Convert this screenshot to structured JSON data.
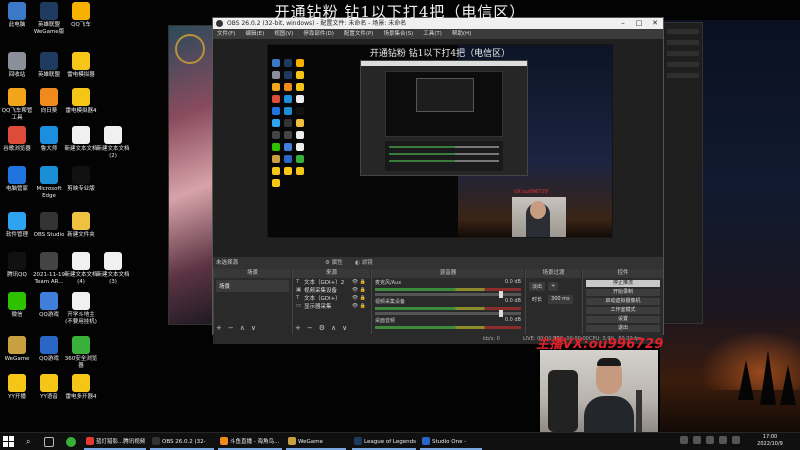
{
  "stream_title": "开通钻粉 钻1以下打4把（电信区）",
  "desktop_icons": [
    {
      "label": "此电脑",
      "color": "#3b78c8"
    },
    {
      "label": "回收站",
      "color": "#8a8f99"
    },
    {
      "label": "QQ飞车帮管工具",
      "color": "#f2a51a"
    },
    {
      "label": "谷歌浏览器",
      "color": "#dd4b39"
    },
    {
      "label": "电脑管家",
      "color": "#1f74e0"
    },
    {
      "label": "软件管理",
      "color": "#2ea3f2"
    },
    {
      "label": "腾讯QQ",
      "color": "#111111"
    },
    {
      "label": "微信",
      "color": "#2dc100"
    },
    {
      "label": "WeGame",
      "color": "#c8a040"
    },
    {
      "label": "YY开播",
      "color": "#f5c518"
    },
    {
      "label": "英雄联盟WeGame版",
      "color": "#1e3a5f"
    },
    {
      "label": "英雄联盟",
      "color": "#1e3a5f"
    },
    {
      "label": "向日葵",
      "color": "#f08a1c"
    },
    {
      "label": "鲁大师",
      "color": "#1c8ee0"
    },
    {
      "label": "Microsoft Edge",
      "color": "#1b8fd6"
    },
    {
      "label": "OBS Studio",
      "color": "#333333"
    },
    {
      "label": "2021-11-19 Team AR...",
      "color": "#444444"
    },
    {
      "label": "QQ游戏",
      "color": "#3f7fd9"
    },
    {
      "label": "QQ游戏",
      "color": "#2a66c4"
    },
    {
      "label": "YY语音",
      "color": "#f5c518"
    },
    {
      "label": "QQ飞车",
      "color": "#f5b000"
    },
    {
      "label": "雷电模拟器",
      "color": "#f5c518"
    },
    {
      "label": "雷电模拟器4",
      "color": "#f5c518"
    },
    {
      "label": "新建文本文档",
      "color": "#f0f0f0"
    },
    {
      "label": "剪映专业版",
      "color": "#111111"
    },
    {
      "label": "新建文件夹",
      "color": "#f0c040"
    },
    {
      "label": "新建文本文档 (4)",
      "color": "#f0f0f0"
    },
    {
      "label": "开学斗地主(不要用挂机)",
      "color": "#f0f0f0"
    },
    {
      "label": "360安全浏览器",
      "color": "#38b03a"
    },
    {
      "label": "雷电多开器4",
      "color": "#f5c518"
    },
    {
      "label": "新建文本文档 (2)",
      "color": "#f0f0f0"
    },
    {
      "label": "新建文本文档 (3)",
      "color": "#f0f0f0"
    }
  ],
  "obs": {
    "title": "OBS 26.0.2 (32-bit, windows) - 配置文件: 未命名 - 场景: 未命名",
    "menu": [
      "文件(F)",
      "编辑(E)",
      "视图(V)",
      "停靠部件(D)",
      "配置文件(P)",
      "场景集合(S)",
      "工具(T)",
      "帮助(H)"
    ],
    "canvas_title": "开通钻粉 钻1以下打4把（电信区）",
    "canvas_watermark": "VX:ou996729",
    "context": {
      "no_source": "未选择源",
      "properties": "属性",
      "filters": "滤镜"
    },
    "docks": {
      "scenes": {
        "header": "场景",
        "items": [
          "场景"
        ]
      },
      "sources": {
        "header": "来源",
        "items": [
          {
            "type": "T",
            "label": "文本（GDI+）2"
          },
          {
            "type": "▣",
            "label": "视频采集设备"
          },
          {
            "type": "T",
            "label": "文本（GDI+）"
          },
          {
            "type": "▭",
            "label": "显示器采集"
          }
        ]
      },
      "mixer": {
        "header": "混音器",
        "channels": [
          {
            "label": "麦克风/Aux",
            "db": "0.0 dB",
            "level": 0.55
          },
          {
            "label": "视频采集设备",
            "db": "0.0 dB",
            "level": 0.45
          },
          {
            "label": "桌面音频",
            "db": "0.0 dB",
            "level": 0.35
          }
        ]
      },
      "transitions": {
        "header": "场景过渡",
        "type": "淡出",
        "duration_label": "时长",
        "duration": "300 ms"
      },
      "controls": {
        "header": "控件",
        "buttons": [
          {
            "label": "停止推流",
            "active": true
          },
          {
            "label": "开始录制",
            "active": false
          },
          {
            "label": "启动虚拟摄像机",
            "active": false
          },
          {
            "label": "工作室模式",
            "active": false
          },
          {
            "label": "设置",
            "active": false
          },
          {
            "label": "退出",
            "active": false
          }
        ]
      }
    },
    "status": {
      "live": "LIVE: 00:00:00",
      "rec": "REC: 00:00:00",
      "cpu": "CPU: 0.9%, 60.00 fps",
      "kbps": "kb/s: 0"
    }
  },
  "streamer_vx": "主播VX:ou996729",
  "taskbar": {
    "apps": [
      {
        "label": "蓝灯猎影...腾讯视频",
        "color": "#e53935"
      },
      {
        "label": "OBS 26.0.2 (32-bi...",
        "color": "#333333"
      },
      {
        "label": "斗鱼直播 - 海角鸟...",
        "color": "#f08a1c"
      },
      {
        "label": "WeGame",
        "color": "#c8a040"
      },
      {
        "label": "League of Legends",
        "color": "#1e3a5f"
      },
      {
        "label": "Studio One - 2022...",
        "color": "#2a66c4"
      }
    ],
    "time": "17:00",
    "date": "2022/10/9"
  }
}
